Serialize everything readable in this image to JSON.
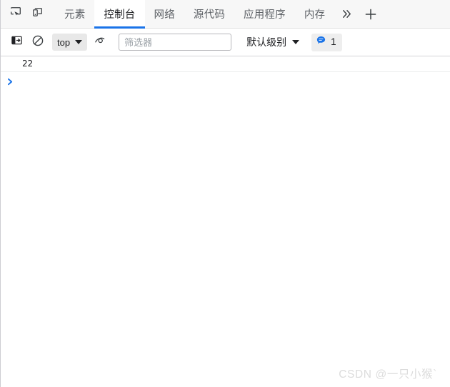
{
  "window": {
    "accent_color": "#1a73e8",
    "background": "#ffffff",
    "tabbar_background": "#f7f7f7"
  },
  "tabbar": {
    "inspect_icon": "inspect-element-icon",
    "device_icon": "device-toolbar-icon",
    "tabs": [
      {
        "id": "elements",
        "label": "元素",
        "active": false
      },
      {
        "id": "console",
        "label": "控制台",
        "active": true
      },
      {
        "id": "network",
        "label": "网络",
        "active": false
      },
      {
        "id": "sources",
        "label": "源代码",
        "active": false
      },
      {
        "id": "application",
        "label": "应用程序",
        "active": false
      },
      {
        "id": "memory",
        "label": "内存",
        "active": false
      }
    ],
    "more_label": "»",
    "more_icon": "chevron-double-right-icon",
    "add_icon": "plus-icon"
  },
  "console_toolbar": {
    "sidebar_toggle_icon": "console-sidebar-icon",
    "clear_icon": "clear-console-icon",
    "context": {
      "label": "top",
      "caret_icon": "chevron-down-icon"
    },
    "eye_icon": "live-expression-eye-icon",
    "filter": {
      "value": "",
      "placeholder": "筛选器"
    },
    "level": {
      "label": "默认级别",
      "caret_icon": "chevron-down-icon"
    },
    "message_badge": {
      "icon": "speech-bubble-icon",
      "icon_color": "#1a73e8",
      "count": "1"
    }
  },
  "console": {
    "messages": [
      {
        "text": "22"
      }
    ],
    "prompt": {
      "chevron_icon": "prompt-chevron-icon",
      "value": "",
      "placeholder": ""
    }
  },
  "watermark": {
    "text": "CSDN @一只小猴`"
  }
}
